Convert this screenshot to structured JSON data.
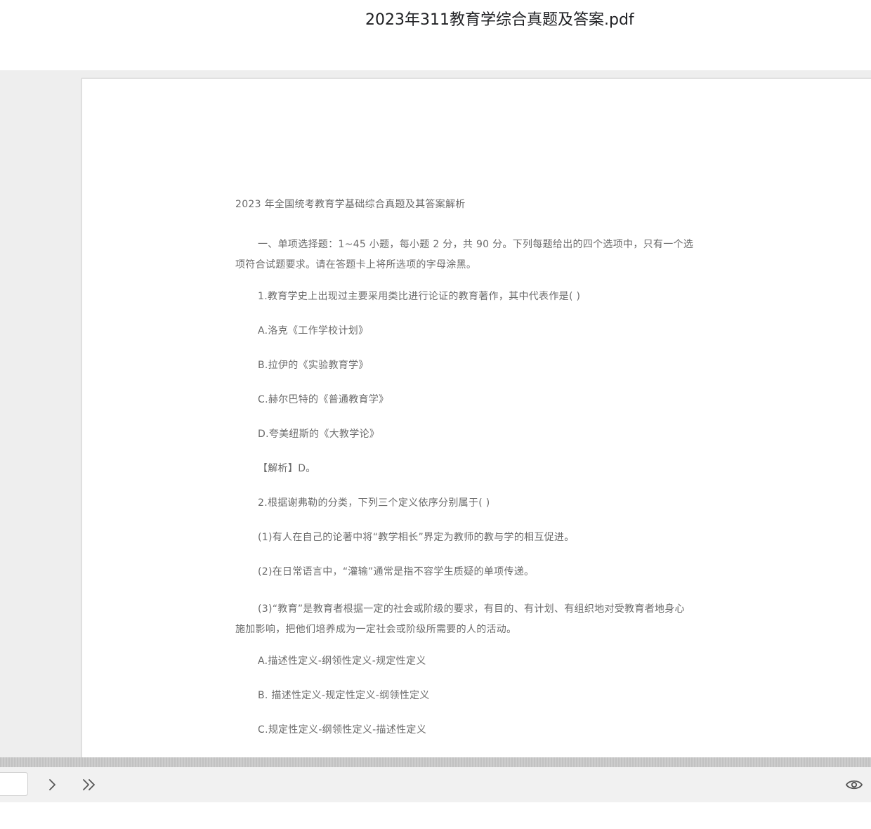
{
  "window": {
    "title": "2023年311教育学综合真题及答案.pdf"
  },
  "document": {
    "heading": "2023 年全国统考教育学基础综合真题及其答案解析",
    "section_line1": "一、单项选择题：1~45 小题，每小题 2 分，共 90 分。下列每题给出的四个选项中，只有一个选",
    "section_line2": "项符合试题要求。请在答题卡上将所选项的字母涂黑。",
    "q1": "1.教育学史上出现过主要采用类比进行论证的教育著作，其中代表作是( )",
    "q1_a": "A.洛克《工作学校计划》",
    "q1_b": "B.拉伊的《实验教育学》",
    "q1_c": "C.赫尔巴特的《普通教育学》",
    "q1_d": "D.夸美纽斯的《大教学论》",
    "q1_answer": "【解析】D。",
    "q2": "2.根据谢弗勒的分类，下列三个定义依序分别属于( )",
    "q2_s1": "(1)有人在自己的论著中将“教学相长”界定为教师的教与学的相互促进。",
    "q2_s2": "(2)在日常语言中，“灌输”通常是指不容学生质疑的单项传递。",
    "q2_s3_line1": "(3)“教育”是教育者根据一定的社会或阶级的要求，有目的、有计划、有组织地对受教育者地身心",
    "q2_s3_line2": "施加影响，把他们培养成为一定社会或阶级所需要的人的活动。",
    "q2_a": "A.描述性定义-纲领性定义-规定性定义",
    "q2_b": "B. 描述性定义-规定性定义-纲领性定义",
    "q2_c": "C.规定性定义-纲领性定义-描述性定义"
  },
  "toolbar": {
    "page_input_value": "",
    "next_icon": "chevron-right-icon",
    "last_icon": "double-chevron-right-icon",
    "view_icon": "eye-icon"
  }
}
